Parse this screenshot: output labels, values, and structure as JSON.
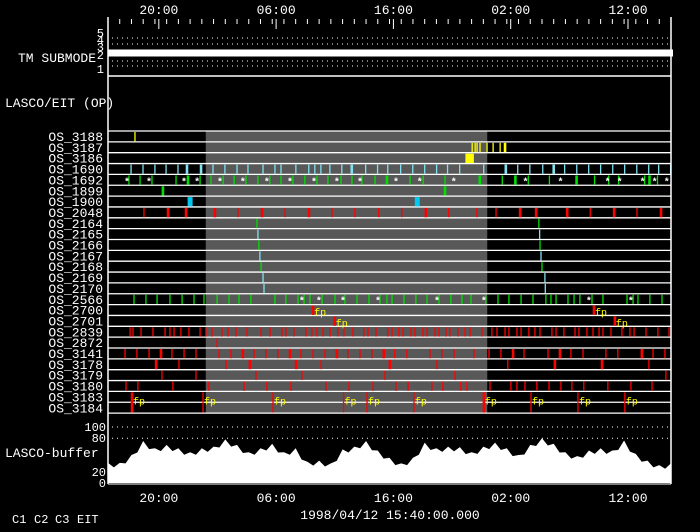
{
  "chart_data": {
    "type": "timeline",
    "time_start": "1998/04/12 15:40",
    "time_span_hours": 48,
    "date_label": "1998/04/12 15:40:00.000",
    "x_ticks": [
      "20:00",
      "06:00",
      "16:00",
      "02:00",
      "12:00"
    ],
    "x_tick_times": [
      "12 20:00",
      "13 06:00",
      "13 16:00",
      "14 02:00",
      "14 12:00"
    ],
    "colors": {
      "C1": "#ff0000",
      "C1dark": "#cc0000",
      "C2": "#00e000",
      "C3": "#80e0f0",
      "C3bright": "#00c8f0",
      "EIT": "#ffff00",
      "shade": "#585858",
      "axis": "#ffffff"
    },
    "shaded_interval": [
      "13 00:00",
      "14 00:00"
    ],
    "tm_submode": {
      "label": "TM SUBMODE",
      "y_ticks": [
        "5",
        "4",
        "3",
        "2",
        "1"
      ],
      "value": 3
    },
    "panel_label": "LASCO/EIT (OP)",
    "rows": [
      {
        "label": "OS_3188",
        "color": "EIT",
        "events": [
          "12 17:58"
        ]
      },
      {
        "label": "OS_3187",
        "color": "EIT",
        "events": [
          "13 22:43",
          "13 22:58",
          "13 23:08",
          "13 23:23",
          "13 23:59",
          "14 00:30",
          "14 01:06",
          "14 01:31"
        ],
        "wide": [
          "14 01:31"
        ]
      },
      {
        "label": "OS_3186",
        "color": "EIT",
        "events": [
          "13 22:15",
          "13 22:25",
          "13 22:35",
          "13 22:45"
        ],
        "wide": [
          "13 22:15",
          "13 22:25",
          "13 22:35",
          "13 22:45"
        ]
      },
      {
        "label": "OS_1690",
        "color": "C3",
        "events": [
          "12 17:38",
          "12 18:39",
          "12 19:40",
          "12 20:37",
          "12 21:38",
          "12 22:24",
          "12 23:36",
          "13 00:37",
          "13 01:38",
          "13 02:40",
          "13 03:36",
          "13 04:53",
          "13 05:54",
          "13 06:25",
          "13 07:41",
          "13 08:47",
          "13 09:18",
          "13 09:49",
          "13 10:35",
          "13 11:36",
          "13 12:27",
          "13 13:38",
          "13 14:39",
          "13 15:31",
          "13 16:37",
          "13 17:39",
          "13 18:40",
          "13 19:41",
          "13 20:37",
          "13 21:39",
          "13 23:42",
          "14 01:35",
          "14 02:36",
          "14 03:38",
          "14 04:44",
          "14 05:40",
          "14 06:36",
          "14 07:38",
          "14 08:39",
          "14 09:40",
          "14 10:42",
          "14 11:43",
          "14 12:45",
          "14 13:46",
          "14 14:37",
          "14 15:38"
        ],
        "wide": [
          "12 22:24",
          "12 23:36",
          "13 12:27",
          "14 01:35",
          "14 05:40"
        ]
      },
      {
        "label": "OS_1692",
        "color": "C2",
        "events": [
          "12 17:27",
          "12 18:24",
          "12 19:25",
          "12 21:28",
          "12 22:29",
          "12 23:31",
          "13 00:27",
          "13 01:29",
          "13 02:25",
          "13 03:26",
          "13 04:27",
          "13 05:28",
          "13 06:25",
          "13 07:26",
          "13 08:27",
          "13 09:29",
          "13 10:25",
          "13 11:32",
          "13 12:28",
          "13 13:19",
          "13 14:26",
          "13 15:27",
          "13 17:25",
          "13 18:32",
          "13 20:24",
          "13 23:22",
          "14 01:17",
          "14 02:24",
          "14 03:30",
          "14 05:18",
          "14 07:37",
          "14 09:09",
          "14 10:21",
          "14 11:12",
          "14 13:25",
          "14 13:50",
          "14 14:31"
        ],
        "wide": [
          "12 22:29",
          "13 15:27",
          "13 23:22",
          "14 02:24",
          "14 07:37",
          "14 13:50"
        ],
        "stars": [
          "12 17:17",
          "12 19:10",
          "12 22:09",
          "12 23:16",
          "13 01:13",
          "13 03:10",
          "13 05:13",
          "13 07:11",
          "13 09:14",
          "13 11:11",
          "13 13:09",
          "13 16:13",
          "13 18:15",
          "13 21:09",
          "14 03:16",
          "14 06:15",
          "14 10:16",
          "14 11:17",
          "14 13:15",
          "14 14:16",
          "14 15:18"
        ]
      },
      {
        "label": "OS_1899",
        "color": "C2",
        "events": [
          "12 20:21",
          "13 20:24"
        ],
        "wide": [
          "12 20:21",
          "13 20:24"
        ]
      },
      {
        "label": "OS_1900",
        "color": "C3bright",
        "events": [
          "12 22:40",
          "13 18:02"
        ],
        "block": [
          "12 22:40",
          "13 18:02"
        ]
      },
      {
        "label": "OS_2048",
        "color": "C1",
        "events": [
          "12 18:44",
          "12 20:47",
          "12 22:19",
          "13 00:47",
          "13 02:45",
          "13 04:48",
          "13 06:46",
          "13 08:48",
          "13 10:46",
          "13 12:43",
          "13 14:45",
          "13 16:43",
          "13 18:46",
          "13 20:43",
          "13 23:07",
          "14 00:45",
          "14 02:48",
          "14 04:10",
          "14 06:49",
          "14 08:47",
          "14 10:49",
          "14 12:46",
          "14 14:49"
        ],
        "wide": [
          "12 20:47",
          "12 22:19",
          "13 00:47",
          "13 04:48",
          "13 08:48",
          "13 18:46",
          "14 02:48",
          "14 04:10",
          "14 06:49",
          "14 10:49",
          "14 14:49"
        ]
      },
      {
        "label": "OS_2164",
        "color": "C2",
        "events": [
          "13 04:22",
          "14 04:24"
        ]
      },
      {
        "label": "OS_2165",
        "color": "C3",
        "events": [
          "13 04:27",
          "14 04:28"
        ]
      },
      {
        "label": "OS_2166",
        "color": "C2",
        "events": [
          "13 04:32",
          "14 04:30"
        ]
      },
      {
        "label": "OS_2167",
        "color": "C3",
        "events": [
          "13 04:37",
          "14 04:35"
        ]
      },
      {
        "label": "OS_2168",
        "color": "C2",
        "events": [
          "13 04:43",
          "14 04:40"
        ]
      },
      {
        "label": "OS_2169",
        "color": "C3",
        "events": [
          "13 04:53",
          "14 04:55"
        ]
      },
      {
        "label": "OS_2170",
        "color": "C3",
        "events": [
          "13 04:58",
          "14 04:57"
        ]
      },
      {
        "label": "OS_2566",
        "color": "C2",
        "events": [
          "12 17:53",
          "12 18:54",
          "12 19:51",
          "12 20:57",
          "12 21:59",
          "12 23:00",
          "12 23:51",
          "13 00:58",
          "13 01:59",
          "13 02:50",
          "13 03:51",
          "13 05:54",
          "13 06:50",
          "13 07:52",
          "13 08:23",
          "13 08:53",
          "13 09:55",
          "13 11:01",
          "13 11:52",
          "13 12:54",
          "13 13:55",
          "13 14:51",
          "13 15:27",
          "13 15:53",
          "13 16:54",
          "13 17:55",
          "13 18:52",
          "13 19:53",
          "13 20:54",
          "13 21:51",
          "13 22:37",
          "13 23:53",
          "14 00:55",
          "14 01:51",
          "14 02:53",
          "14 03:54",
          "14 05:00",
          "14 05:26",
          "14 05:52",
          "14 06:53",
          "14 07:24",
          "14 07:54",
          "14 08:56",
          "14 09:52",
          "14 11:55",
          "14 12:26",
          "14 12:51",
          "14 13:52",
          "14 14:54"
        ],
        "stars": [
          "13 08:12",
          "13 09:39",
          "13 11:42",
          "13 14:41",
          "13 19:43",
          "13 23:43",
          "14 08:40",
          "14 12:15"
        ]
      },
      {
        "label": "OS_2700",
        "color": "C1",
        "events": [
          "13 09:09",
          "14 09:06"
        ],
        "wide": [
          "13 09:09",
          "14 09:06"
        ],
        "fp": [
          "13 09:09",
          "14 09:06"
        ]
      },
      {
        "label": "OS_2701",
        "color": "C1",
        "events": [
          "13 11:00",
          "14 10:53"
        ],
        "wide": [
          "13 11:00",
          "14 10:53"
        ],
        "fp": [
          "13 11:00",
          "14 10:53"
        ]
      },
      {
        "label": "OS_2839",
        "color": "C1",
        "events": [
          "12 17:33",
          "12 17:48",
          "12 18:29",
          "12 19:30",
          "12 20:32",
          "12 20:57",
          "12 21:18",
          "12 21:53",
          "12 22:34",
          "12 23:31",
          "13 00:01",
          "13 00:32",
          "13 01:23",
          "13 01:54",
          "13 02:35",
          "13 03:31",
          "13 04:43",
          "13 05:29",
          "13 06:30",
          "13 06:50",
          "13 07:31",
          "13 08:33",
          "13 09:03",
          "13 09:29",
          "13 10:00",
          "13 10:36",
          "13 11:16",
          "13 11:47",
          "13 12:33",
          "13 13:29",
          "13 13:50",
          "13 14:31",
          "13 15:32",
          "13 15:53",
          "13 16:28",
          "13 16:49",
          "13 17:30",
          "13 17:50",
          "13 18:31",
          "13 18:52",
          "13 19:33",
          "13 19:53",
          "13 20:29",
          "13 20:49",
          "13 21:30",
          "13 22:06",
          "13 22:32",
          "13 23:33",
          "14 00:24",
          "14 00:50",
          "14 01:31",
          "14 01:51",
          "14 02:32",
          "14 02:53",
          "14 03:33",
          "14 04:04",
          "14 04:30",
          "14 05:31",
          "14 05:52",
          "14 06:32",
          "14 07:29",
          "14 07:49",
          "14 08:30",
          "14 09:01",
          "14 09:32",
          "14 09:52",
          "14 10:33",
          "14 11:29",
          "14 12:10",
          "14 12:31",
          "14 13:32",
          "14 14:33",
          "14 15:30"
        ]
      },
      {
        "label": "OS_2872",
        "color": "C1",
        "events": [
          "13 00:58"
        ]
      },
      {
        "label": "OS_3141",
        "color": "C1",
        "events": [
          "12 17:07",
          "12 18:08",
          "12 19:10",
          "12 20:11",
          "12 21:07",
          "12 22:09",
          "12 23:10",
          "13 01:08",
          "13 02:09",
          "13 03:10",
          "13 04:07",
          "13 05:08",
          "13 06:09",
          "13 07:11",
          "13 08:07",
          "13 09:09",
          "13 10:10",
          "13 11:11",
          "13 12:07",
          "13 13:09",
          "13 14:10",
          "13 15:11",
          "13 16:07",
          "13 17:09",
          "13 19:07",
          "13 20:08",
          "13 21:10",
          "13 22:52",
          "14 00:09",
          "14 01:10",
          "14 02:12",
          "14 03:08",
          "14 05:11",
          "14 06:12",
          "14 07:08",
          "14 08:10",
          "14 10:07",
          "14 11:08",
          "14 13:11",
          "14 14:08",
          "14 15:09"
        ],
        "wide": [
          "12 20:11",
          "13 03:10",
          "13 07:11",
          "13 11:11",
          "13 15:11",
          "14 02:12",
          "14 06:12",
          "14 13:11"
        ]
      },
      {
        "label": "OS_3178",
        "color": "C1",
        "events": [
          "12 19:46",
          "12 21:43",
          "13 01:44",
          "13 03:46",
          "13 07:42",
          "13 09:50",
          "13 15:42",
          "13 19:43",
          "14 01:45",
          "14 05:46",
          "14 09:47",
          "14 13:47"
        ],
        "wide": [
          "12 19:46",
          "13 03:46",
          "13 07:42",
          "13 15:42",
          "14 05:46",
          "14 09:47"
        ]
      },
      {
        "label": "OS_3179",
        "color": "C1",
        "events": [
          "12 20:16",
          "12 23:10",
          "13 04:17",
          "13 08:12",
          "13 15:17",
          "13 21:15",
          "14 15:14"
        ]
      },
      {
        "label": "OS_3180",
        "color": "C1",
        "events": [
          "12 17:12",
          "12 18:13",
          "12 21:12",
          "13 00:16",
          "13 03:16",
          "13 05:13",
          "13 07:16",
          "13 10:15",
          "13 12:13",
          "13 14:16",
          "13 16:13",
          "13 17:15",
          "13 19:17",
          "13 20:13",
          "13 21:45",
          "13 22:16",
          "14 00:14",
          "14 02:01",
          "14 02:32",
          "14 03:13",
          "14 04:14",
          "14 05:16",
          "14 06:17",
          "14 07:13",
          "14 08:14",
          "14 10:17",
          "14 12:15",
          "14 14:03"
        ]
      },
      {
        "label": "OS_3183",
        "color": "C1",
        "span": 2,
        "events": [
          "12 17:43",
          "12 23:46",
          "13 05:44",
          "13 11:45",
          "13 13:45",
          "13 17:45",
          "13 23:43",
          "14 03:44",
          "14 07:44",
          "14 11:44"
        ],
        "wide": [
          "12 17:43",
          "13 23:43"
        ],
        "fp": [
          "12 17:43",
          "12 23:46",
          "13 05:44",
          "13 11:45",
          "13 13:45",
          "13 17:45",
          "13 23:43",
          "14 03:44",
          "14 07:44",
          "14 11:44"
        ]
      },
      {
        "label": "OS_3184",
        "color": "C1",
        "events": []
      }
    ],
    "buffer": {
      "label": "LASCO-buffer",
      "y_ticks": [
        "100",
        "80",
        "20",
        "0"
      ],
      "y_tick_values": [
        100,
        80,
        20,
        0
      ],
      "ylim": [
        0,
        100
      ],
      "dotted_levels": [
        100,
        80
      ],
      "interval_hours": 1,
      "values": [
        36,
        36,
        50,
        75,
        62,
        68,
        62,
        55,
        62,
        65,
        78,
        68,
        55,
        62,
        70,
        55,
        62,
        38,
        40,
        35,
        60,
        65,
        75,
        58,
        45,
        35,
        45,
        72,
        62,
        65,
        64,
        55,
        65,
        72,
        62,
        50,
        68,
        80,
        70,
        55,
        48,
        58,
        62,
        58,
        76,
        52,
        40,
        32,
        35
      ]
    },
    "legend": [
      {
        "label": "C1",
        "color": "#ff0000"
      },
      {
        "label": "C2",
        "color": "#00e000"
      },
      {
        "label": "C3",
        "color": "#80e0f0"
      },
      {
        "label": "EIT",
        "color": "#ffff00"
      }
    ]
  }
}
